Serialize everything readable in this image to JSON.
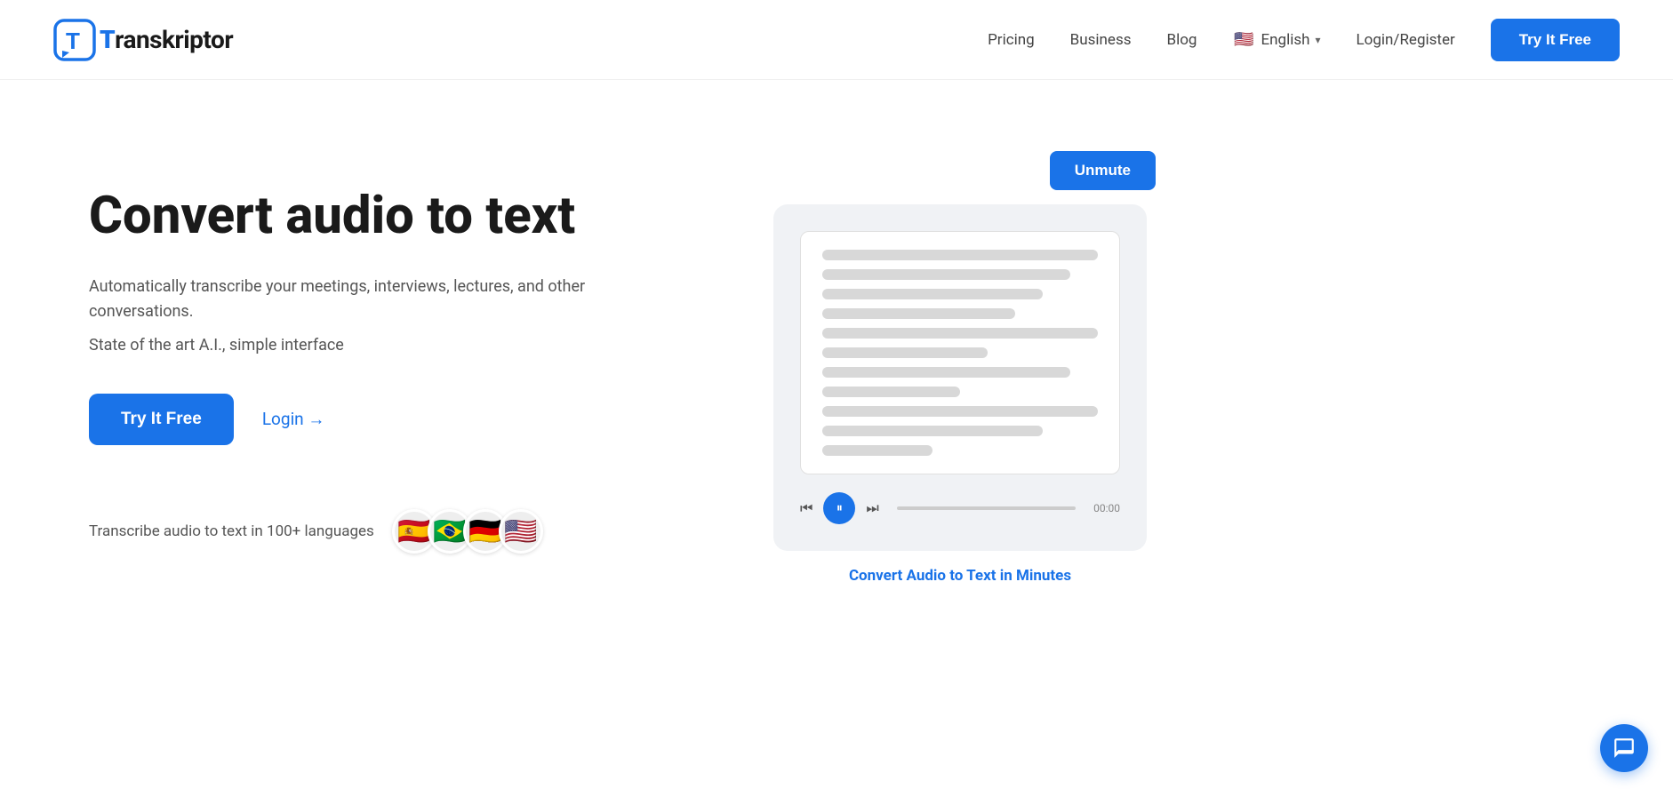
{
  "brand": {
    "logo_letter": "T",
    "name_prefix": "ranskriptor"
  },
  "navbar": {
    "pricing_label": "Pricing",
    "business_label": "Business",
    "blog_label": "Blog",
    "language_label": "English",
    "login_register_label": "Login/Register",
    "try_free_label": "Try It Free",
    "flag_emoji": "🇺🇸"
  },
  "hero": {
    "title": "Convert audio to text",
    "subtitle_line1": "Automatically transcribe your meetings, interviews, lectures, and other",
    "subtitle_line2": "conversations.",
    "subtitle_line3": "State of the art A.I., simple interface",
    "try_btn_label": "Try It Free",
    "login_label": "Login →",
    "languages_text": "Transcribe audio to text in 100+ languages",
    "flags": [
      "🇪🇸",
      "🇧🇷",
      "🇩🇪",
      "🇺🇸"
    ]
  },
  "video_card": {
    "unmute_label": "Unmute",
    "caption": "Convert Audio to Text in Minutes",
    "play_pause_icon": "⏸",
    "skip_back_icon": "⏮",
    "skip_forward_icon": "⏭",
    "time_label": "00:00"
  },
  "chat": {
    "icon_label": "chat-icon"
  }
}
